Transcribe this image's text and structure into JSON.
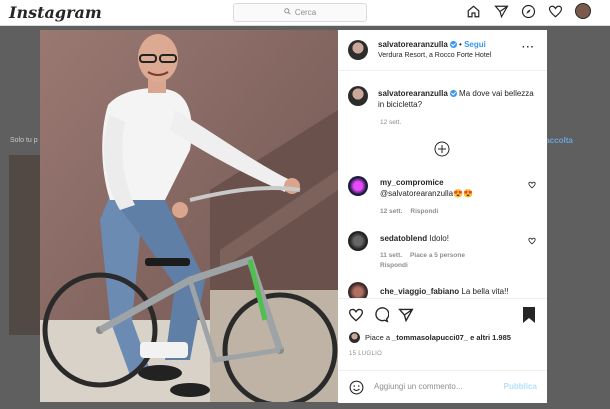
{
  "header": {
    "logo": "Instagram",
    "search_placeholder": "Cerca",
    "nav_icons": [
      "home-icon",
      "direct-icon",
      "explore-icon",
      "heart-icon",
      "profile-avatar"
    ]
  },
  "background": {
    "left_text": "Solo tu p",
    "right_link": "va raccolta"
  },
  "post": {
    "author": "salvatorearanzulla",
    "follow_label": "Segui",
    "location": "Verdura Resort, a Rocco Forte Hotel",
    "caption": "Ma dove vai bellezza in bicicletta?",
    "caption_time": "12 sett.",
    "load_more": "+",
    "comments": [
      {
        "user": "my_compromice",
        "text": "@salvatorearanzulla😍😍",
        "time": "12 sett.",
        "reply": "Rispondi",
        "likes": ""
      },
      {
        "user": "sedatoblend",
        "text": "Idolo!",
        "time": "11 sett.",
        "likes": "Piace a 5 persone",
        "reply": "Rispondi"
      },
      {
        "user": "che_viaggio_fabiano",
        "text": "La bella vita!!",
        "time": "",
        "reply": "",
        "likes": ""
      }
    ],
    "liked_by_prefix": "Piace a ",
    "liked_by_user": "_tommasolapucci07_",
    "liked_by_suffix": " e altri 1.985",
    "date": "15 LUGLIO",
    "add_comment_placeholder": "Aggiungi un commento...",
    "publish_label": "Pubblica"
  },
  "colors": {
    "accent": "#3897f0",
    "publish_disabled": "#b2dffc"
  }
}
